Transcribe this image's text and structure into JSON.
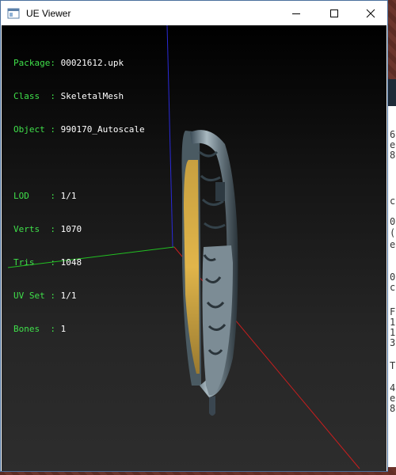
{
  "window": {
    "title": "UE Viewer",
    "controls": {
      "minimize_icon": "minimize-icon",
      "maximize_icon": "maximize-icon",
      "close_icon": "close-icon"
    }
  },
  "info": {
    "rows1": [
      {
        "label": "Package",
        "value": "00021612.upk"
      },
      {
        "label": "Class  ",
        "value": "SkeletalMesh"
      },
      {
        "label": "Object ",
        "value": "990170_Autoscale"
      }
    ],
    "rows2": [
      {
        "label": "LOD    ",
        "value": "1/1"
      },
      {
        "label": "Verts  ",
        "value": "1070"
      },
      {
        "label": "Tris   ",
        "value": "1048"
      },
      {
        "label": "UV Set ",
        "value": "1/1"
      },
      {
        "label": "Bones  ",
        "value": "1"
      }
    ]
  },
  "background_window": {
    "chars": [
      "6",
      "e",
      "8",
      "",
      "c",
      "",
      "0",
      "(",
      "e",
      "",
      "0",
      "c",
      "",
      "F",
      "1",
      "1",
      "3",
      "",
      "T",
      "",
      "4",
      "e",
      "8"
    ]
  },
  "colors": {
    "label_green": "#3fe04a",
    "axis_x": "#c81e1e",
    "axis_y": "#22c022",
    "axis_z": "#2a2ad8"
  }
}
